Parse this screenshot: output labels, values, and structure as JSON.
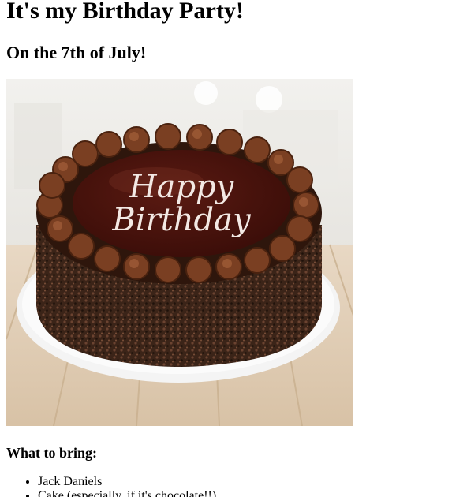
{
  "page": {
    "title": "It's my Birthday Party!",
    "subtitle": "On the 7th of July!",
    "image": {
      "icon": "birthday-cake-photo",
      "cake_text_line1": "Happy",
      "cake_text_line2": "Birthday"
    },
    "bring_heading": "What to bring:",
    "bring_items": [
      "Jack Daniels",
      "Cake (especially, if it's chocolate!!)"
    ]
  }
}
